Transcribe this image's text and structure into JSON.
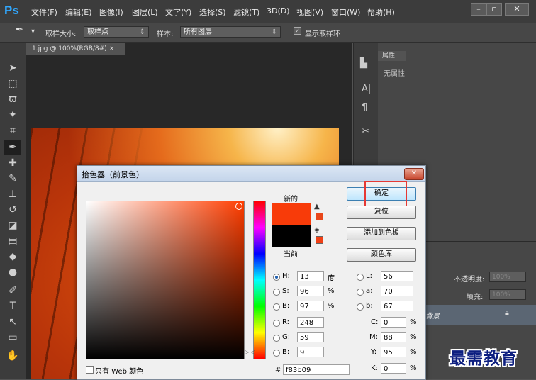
{
  "app": {
    "logo": "Ps"
  },
  "menu": {
    "items": [
      "文件(F)",
      "编辑(E)",
      "图像(I)",
      "图层(L)",
      "文字(Y)",
      "选择(S)",
      "滤镜(T)",
      "3D(D)",
      "视图(V)",
      "窗口(W)",
      "帮助(H)"
    ],
    "window_controls": [
      "minimize",
      "maximize",
      "close"
    ]
  },
  "options_bar": {
    "sample_size_label": "取样大小:",
    "sample_size_value": "取样点",
    "sample_label": "样本:",
    "sample_value": "所有图层",
    "show_ring_label": "显示取样环"
  },
  "document": {
    "tab_title": "1.jpg @ 100%(RGB/8#)"
  },
  "properties_panel": {
    "tab_label": "属性",
    "empty_text": "无属性"
  },
  "layers_panel": {
    "opacity_label": "不透明度:",
    "opacity_value": "100%",
    "fill_label": "填充:",
    "fill_value": "100%",
    "layer_name": "背景"
  },
  "color_picker": {
    "title": "拾色器（前景色）",
    "new_label": "新的",
    "current_label": "当前",
    "new_color": "#f83b09",
    "current_color": "#000000",
    "buttons": {
      "ok": "确定",
      "reset": "复位",
      "add_to_swatches": "添加到色板",
      "color_libraries": "颜色库"
    },
    "fields": {
      "H": {
        "label": "H:",
        "value": "13",
        "unit": "度"
      },
      "S": {
        "label": "S:",
        "value": "96",
        "unit": "%"
      },
      "Bv": {
        "label": "B:",
        "value": "97",
        "unit": "%"
      },
      "R": {
        "label": "R:",
        "value": "248"
      },
      "G": {
        "label": "G:",
        "value": "59"
      },
      "B": {
        "label": "B:",
        "value": "9"
      },
      "L": {
        "label": "L:",
        "value": "56"
      },
      "a": {
        "label": "a:",
        "value": "70"
      },
      "b": {
        "label": "b:",
        "value": "67"
      },
      "C": {
        "label": "C:",
        "value": "0",
        "unit": "%"
      },
      "M": {
        "label": "M:",
        "value": "88",
        "unit": "%"
      },
      "Y": {
        "label": "Y:",
        "value": "95",
        "unit": "%"
      },
      "K": {
        "label": "K:",
        "value": "0",
        "unit": "%"
      }
    },
    "hex_label": "#",
    "hex_value": "f83b09",
    "web_only_label": "只有 Web 颜色"
  },
  "watermark": "最需教育"
}
